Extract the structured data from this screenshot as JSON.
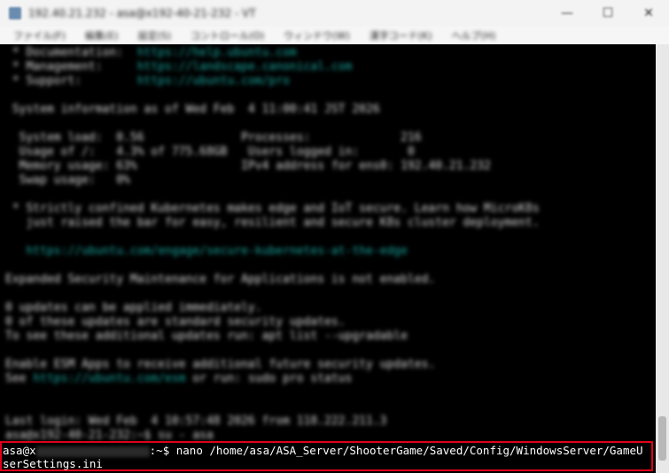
{
  "window": {
    "title": "192.40.21.232 - asa@x192-40-21-232 - VT",
    "controls": {
      "minimize": "—",
      "maximize": "☐",
      "close": "✕"
    }
  },
  "menu": {
    "items": [
      "ファイル(F)",
      "編集(E)",
      "設定(S)",
      "コントロール(O)",
      "ウィンドウ(W)",
      "漢字コード(K)",
      "ヘルプ(H)"
    ]
  },
  "terminal": {
    "lines": [
      {
        "text": " * Documentation:  ",
        "link": "https://help.ubuntu.com"
      },
      {
        "text": " * Management:     ",
        "link": "https://landscape.canonical.com"
      },
      {
        "text": " * Support:        ",
        "link": "https://ubuntu.com/pro"
      },
      {
        "text": ""
      },
      {
        "text": " System information as of Wed Feb  4 11:00:41 JST 2026"
      },
      {
        "text": ""
      },
      {
        "text": "  System load:  0.56              Processes:             216"
      },
      {
        "text": "  Usage of /:   4.3% of 775.68GB   Users logged in:       0"
      },
      {
        "text": "  Memory usage: 63%               IPv4 address for ens0: 192.40.21.232"
      },
      {
        "text": "  Swap usage:   0%"
      },
      {
        "text": ""
      },
      {
        "text": " * Strictly confined Kubernetes makes edge and IoT secure. Learn how MicroK8s"
      },
      {
        "text": "   just raised the bar for easy, resilient and secure K8s cluster deployment."
      },
      {
        "text": ""
      },
      {
        "text": "   ",
        "link": "https://ubuntu.com/engage/secure-kubernetes-at-the-edge"
      },
      {
        "text": ""
      },
      {
        "text": "Expanded Security Maintenance for Applications is not enabled."
      },
      {
        "text": ""
      },
      {
        "text": "0 updates can be applied immediately."
      },
      {
        "text": "0 of these updates are standard security updates."
      },
      {
        "text": "To see these additional updates run: apt list --upgradable"
      },
      {
        "text": ""
      },
      {
        "text": "Enable ESM Apps to receive additional future security updates."
      },
      {
        "text": "See ",
        "link": "https://ubuntu.com/esm",
        "suffix": " or run: sudo pro status"
      },
      {
        "text": ""
      },
      {
        "text": ""
      },
      {
        "text": "Last login: Wed Feb  4 10:57:48 2026 from 118.222.211.3"
      },
      {
        "text": "asa@x192-40-21-232:~$ su - asa"
      }
    ],
    "prompt": {
      "user": "asa@x",
      "suffix": ":~$ nano /home/asa/ASA_Server/ShooterGame/Saved/Config/WindowsServer/GameU",
      "wrap": "serSettings.ini"
    }
  }
}
